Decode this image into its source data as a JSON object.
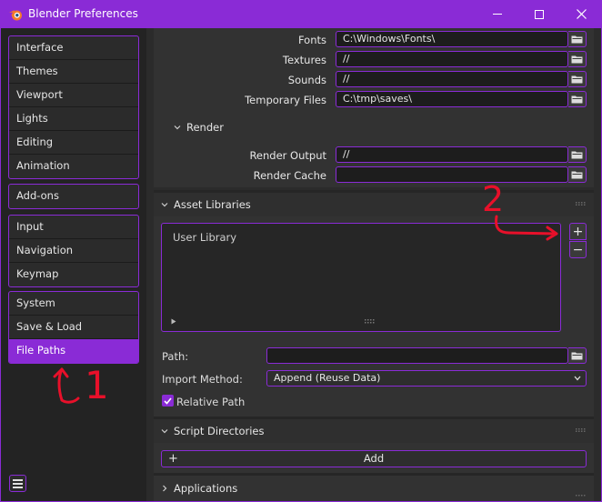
{
  "window": {
    "title": "Blender Preferences"
  },
  "sidebar": {
    "groups": [
      [
        "Interface",
        "Themes",
        "Viewport",
        "Lights",
        "Editing",
        "Animation"
      ],
      [
        "Add-ons"
      ],
      [
        "Input",
        "Navigation",
        "Keymap"
      ],
      [
        "System",
        "Save & Load",
        "File Paths"
      ]
    ],
    "active": "File Paths"
  },
  "data_paths": {
    "fonts": {
      "label": "Fonts",
      "value": "C:\\Windows\\Fonts\\"
    },
    "textures": {
      "label": "Textures",
      "value": "//"
    },
    "sounds": {
      "label": "Sounds",
      "value": "//"
    },
    "temp": {
      "label": "Temporary Files",
      "value": "C:\\tmp\\saves\\"
    }
  },
  "render": {
    "header": "Render",
    "output": {
      "label": "Render Output",
      "value": "//"
    },
    "cache": {
      "label": "Render Cache",
      "value": ""
    }
  },
  "asset_libraries": {
    "header": "Asset Libraries",
    "items": [
      "User Library"
    ],
    "add_symbol": "+",
    "remove_symbol": "−",
    "path_label": "Path:",
    "path_value": "",
    "import_label": "Import Method:",
    "import_value": "Append (Reuse Data)",
    "relative_label": "Relative Path",
    "relative_checked": true
  },
  "script_directories": {
    "header": "Script Directories",
    "add_label": "Add"
  },
  "applications": {
    "header": "Applications"
  },
  "annotations": {
    "one": "1",
    "two": "2",
    "color": "#e8102a"
  },
  "colors": {
    "accent": "#8a2bd6",
    "background": "#2b2b2b"
  }
}
